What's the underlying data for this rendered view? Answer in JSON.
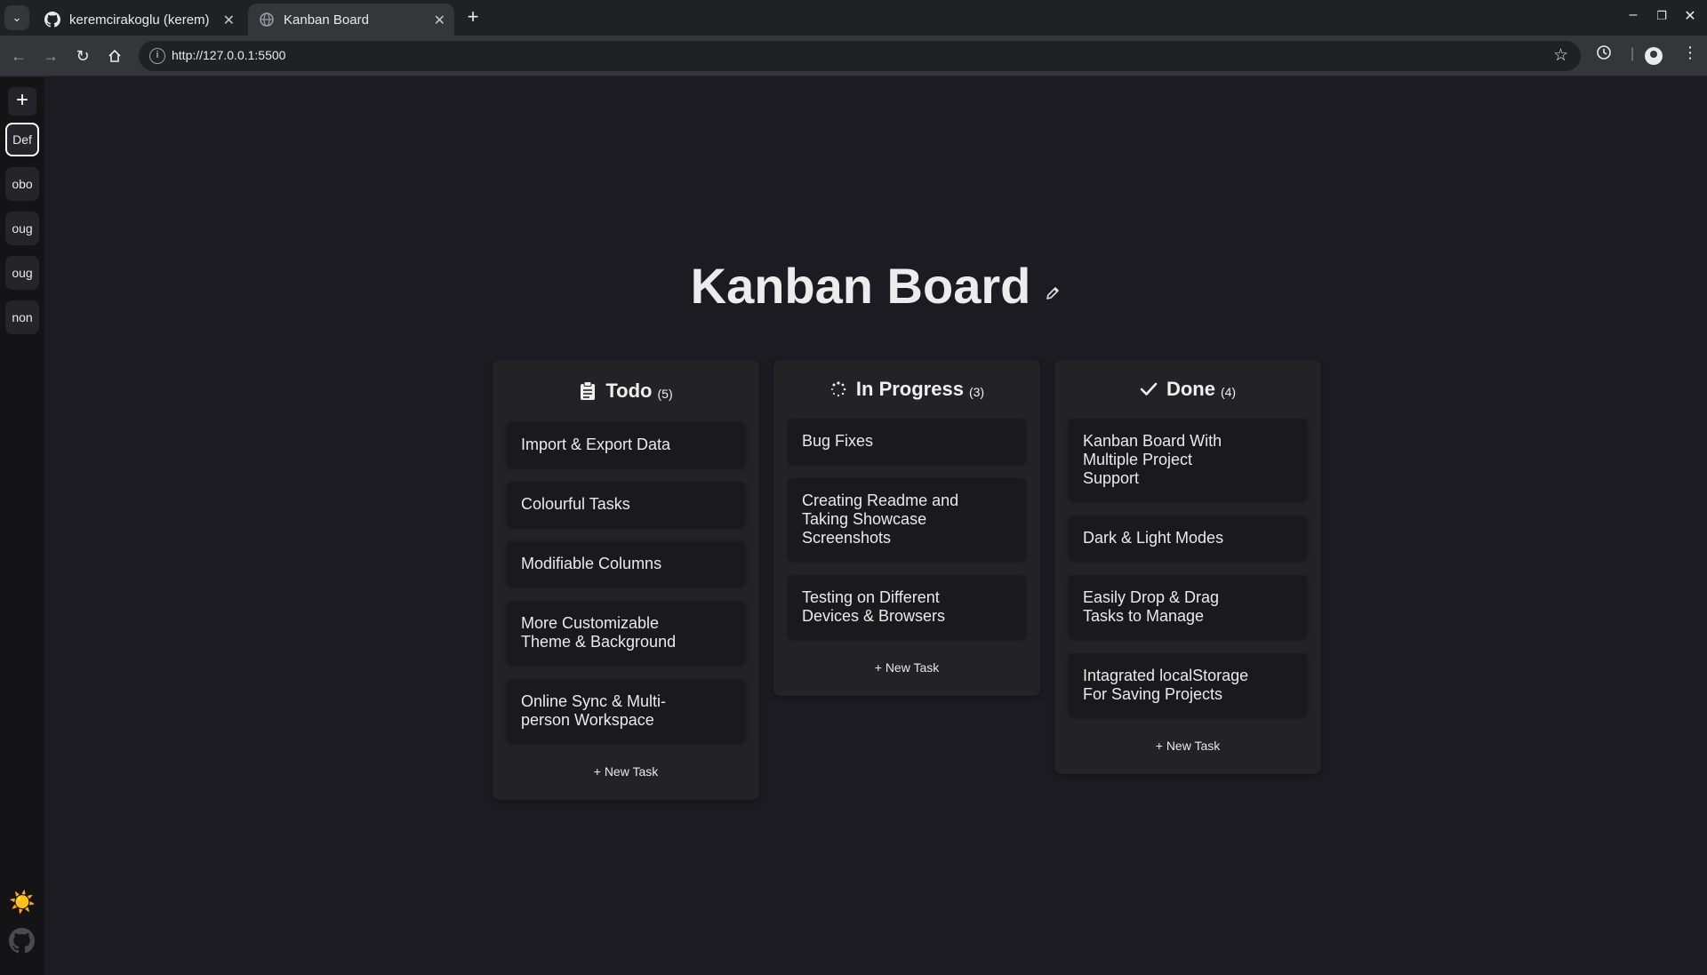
{
  "browser": {
    "tabs": [
      {
        "title": "keremcirakoglu (kerem)",
        "icon": "github-icon"
      },
      {
        "title": "Kanban Board",
        "icon": "globe-icon"
      }
    ],
    "url": "http://127.0.0.1:5500"
  },
  "sidebar": {
    "add_label": "+",
    "projects": [
      "Def",
      "obo",
      "oug",
      "oug",
      "non"
    ],
    "active_project": "Def",
    "theme_icon": "☀️"
  },
  "board": {
    "title": "Kanban Board",
    "new_task_label": "+ New Task",
    "columns": [
      {
        "name": "Todo",
        "count": "(5)",
        "icon": "clipboard-icon",
        "tasks": [
          "Import & Export Data",
          "Colourful Tasks",
          "Modifiable Columns",
          "More Customizable Theme & Background",
          "Online Sync & Multi-person Workspace"
        ]
      },
      {
        "name": "In Progress",
        "count": "(3)",
        "icon": "spinner-icon",
        "tasks": [
          "Bug Fixes",
          "Creating Readme and Taking Showcase Screenshots",
          "Testing on Different Devices & Browsers"
        ]
      },
      {
        "name": "Done",
        "count": "(4)",
        "icon": "check-icon",
        "tasks": [
          "Kanban Board With Multiple Project Support",
          "Dark & Light Modes",
          "Easily Drop & Drag Tasks to Manage",
          "Intagrated localStorage For Saving Projects"
        ]
      }
    ]
  }
}
